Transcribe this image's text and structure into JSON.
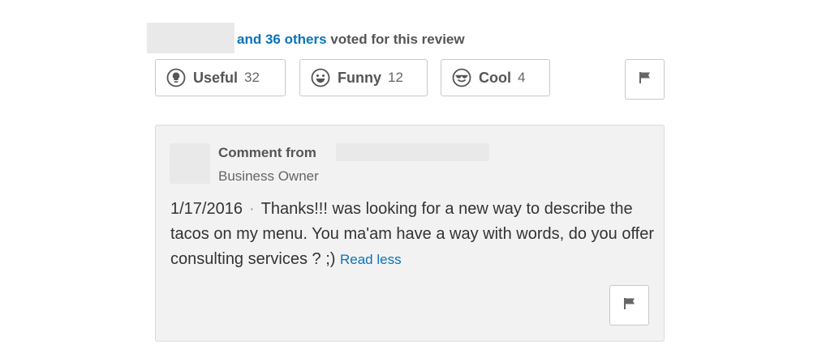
{
  "vote_summary": {
    "link_text": "and 36 others",
    "rest_text": "voted for this review"
  },
  "vote_buttons": [
    {
      "icon": "lightbulb-icon",
      "label": "Useful",
      "count": "32"
    },
    {
      "icon": "smiley-icon",
      "label": "Funny",
      "count": "12"
    },
    {
      "icon": "sunglasses-icon",
      "label": "Cool",
      "count": "4"
    }
  ],
  "comment": {
    "heading": "Comment from",
    "role": "Business Owner",
    "date": "1/17/2016",
    "separator": "·",
    "text": "Thanks!!! was looking for a new way to describe the tacos on my menu. You ma'am have a way with words, do you offer consulting services ? ;)",
    "read_less": "Read less"
  },
  "colors": {
    "link": "#0a73bb",
    "comment_bg": "#f2f2f2",
    "border": "#c8c8c8"
  }
}
